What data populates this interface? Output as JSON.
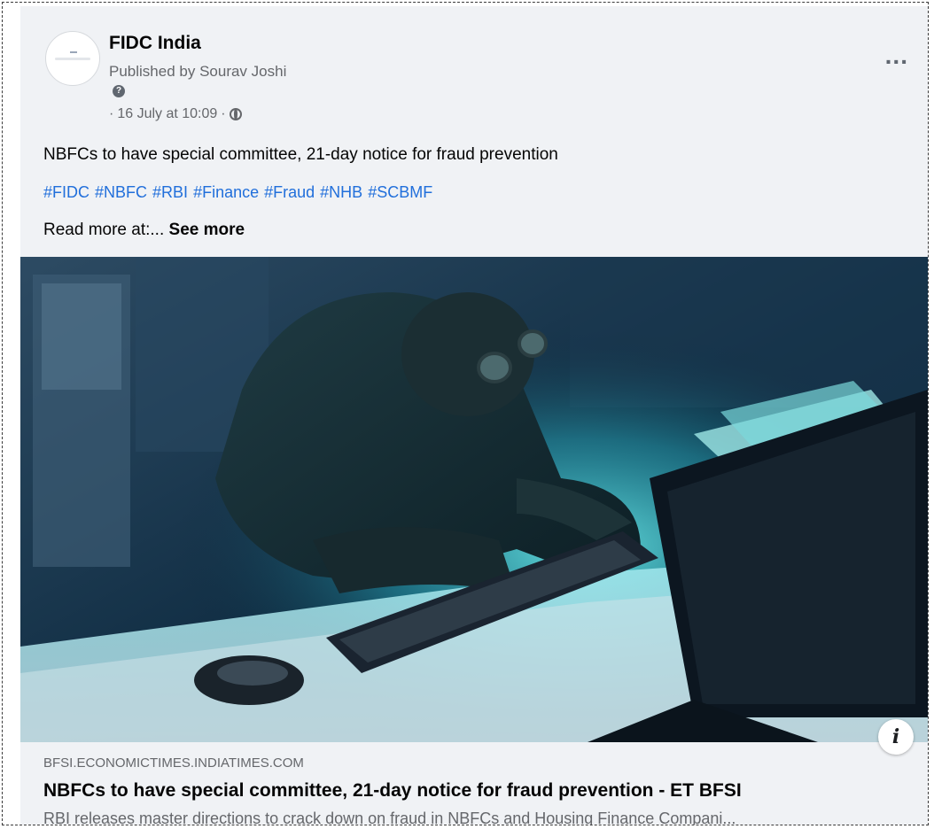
{
  "post": {
    "page_name": "FIDC India",
    "publisher": "Published by Sourav Joshi",
    "help_icon_glyph": "?",
    "meta_prefix": "·",
    "date": "16 July at 10:09",
    "meta_separator": "·",
    "audience_icon": "globe-icon",
    "more_icon": "...",
    "text": "NBFCs to have special committee, 21-day notice for fraud prevention",
    "hashtags": [
      "#FIDC",
      "#NBFC",
      "#RBI",
      "#Finance",
      "#Fraud",
      "#NHB",
      "#SCBMF"
    ],
    "read_more_text": "Read more at:...",
    "see_more_label": "See more"
  },
  "link_preview": {
    "info_icon": "i",
    "domain": "BFSI.ECONOMICTIMES.INDIATIMES.COM",
    "title": "NBFCs to have special committee, 21-day notice for fraud prevention - ET BFSI",
    "description": "RBI releases master directions to crack down on fraud in NBFCs and Housing Finance Compani..."
  },
  "colors": {
    "hashtag": "#216fdb",
    "card_background": "#f0f2f5",
    "secondary_text": "#65676b",
    "image_glow": "#3fe0e8"
  }
}
